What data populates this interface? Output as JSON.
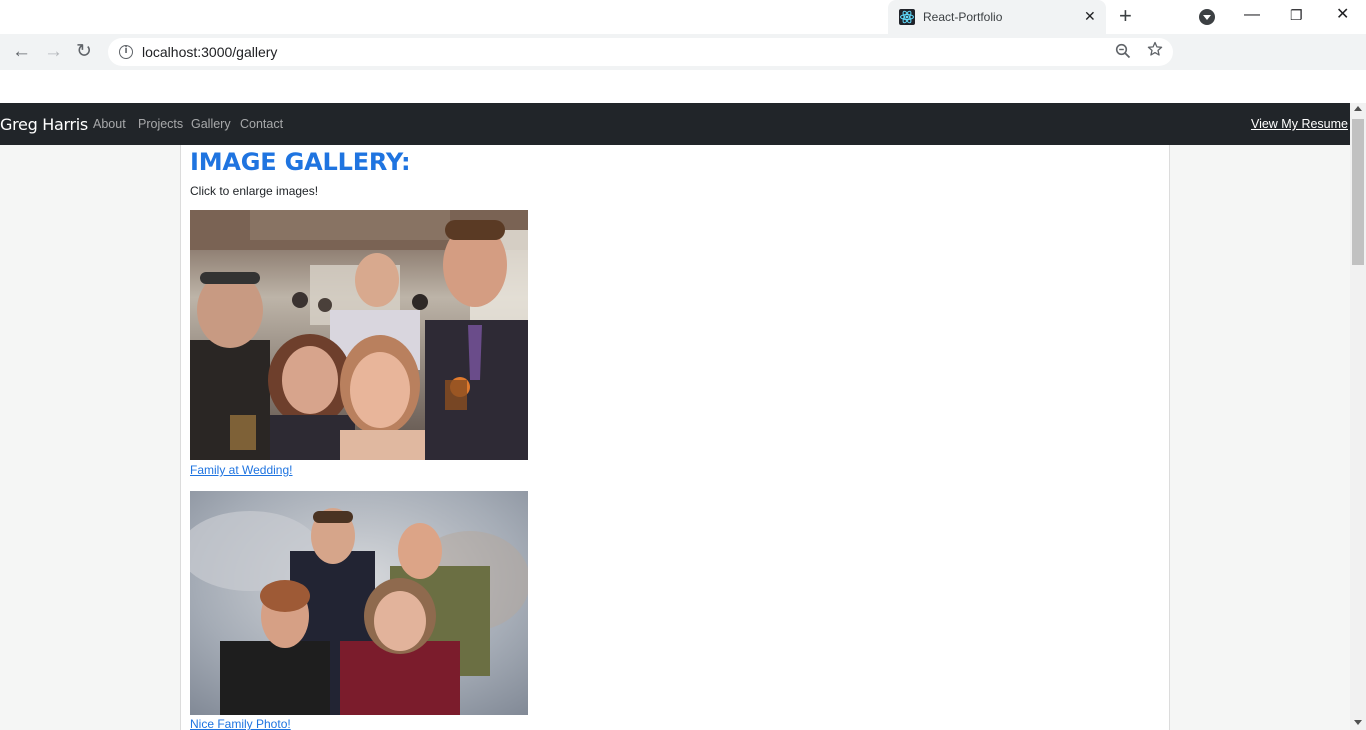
{
  "browser": {
    "tab_title": "React-Portfolio",
    "tab_close": "✕",
    "new_tab": "+",
    "url": "localhost:3000/gallery",
    "back": "←",
    "forward": "→",
    "reload": "↻",
    "minimize": "—",
    "maximize": "❐",
    "close": "✕",
    "icons": [
      "react-favicon-icon",
      "tab-search-icon",
      "info-icon",
      "zoom-icon",
      "star-icon"
    ]
  },
  "navbar": {
    "brand": "Greg Harris",
    "links": [
      "About",
      "Projects",
      "Gallery",
      "Contact"
    ],
    "resume": "View My Resume"
  },
  "gallery": {
    "title": "IMAGE GALLERY:",
    "instructions": "Click to enlarge images!",
    "images": [
      {
        "caption": "Family at Wedding!"
      },
      {
        "caption": "Nice Family Photo!"
      }
    ]
  },
  "colors": {
    "navbar_bg": "#212529",
    "link_blue": "#1f74e0",
    "page_bg": "#f5f6f5"
  }
}
